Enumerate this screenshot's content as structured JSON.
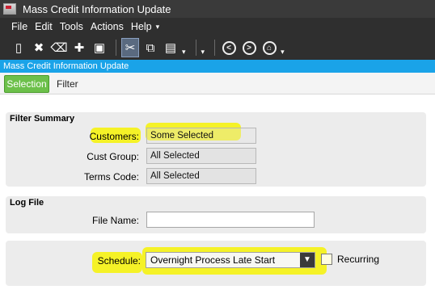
{
  "window": {
    "title": "Mass Credit Information Update"
  },
  "menu": {
    "items": [
      "File",
      "Edit",
      "Tools",
      "Actions",
      "Help"
    ],
    "help_dropdown": "▾"
  },
  "toolbar": {
    "icons": [
      "new-icon",
      "delete-icon",
      "clear-icon",
      "attach-icon",
      "print-preview-icon",
      "cut-icon",
      "copy-icon",
      "paste-icon",
      "back-icon",
      "forward-icon",
      "home-icon"
    ]
  },
  "form_header": {
    "title": "Mass Credit Information Update"
  },
  "tabs": [
    {
      "label": "Selection",
      "active": true
    },
    {
      "label": "Filter",
      "active": false
    }
  ],
  "filter_summary": {
    "title": "Filter Summary",
    "rows": [
      {
        "label": "Customers:",
        "value": "Some Selected"
      },
      {
        "label": "Cust Group:",
        "value": "All Selected"
      },
      {
        "label": "Terms Code:",
        "value": "All Selected"
      }
    ]
  },
  "log_file": {
    "title": "Log File",
    "file_name_label": "File Name:",
    "file_name_value": ""
  },
  "schedule": {
    "label": "Schedule:",
    "value": "Overnight Process Late Start",
    "recurring_label": "Recurring",
    "recurring_checked": false
  },
  "colors": {
    "accent_blue": "#1aa3e8",
    "active_tab_green": "#6cc04a",
    "highlight_yellow": "#f5f21c"
  }
}
